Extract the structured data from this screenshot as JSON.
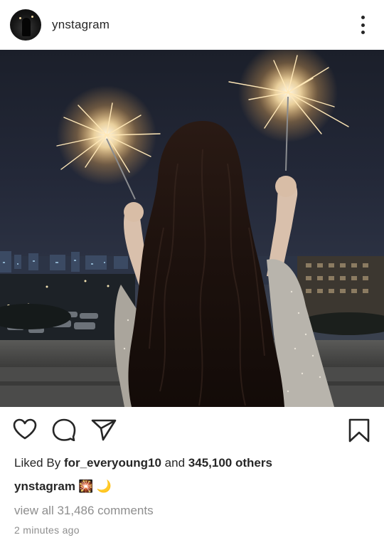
{
  "post": {
    "username": "ynstagram",
    "likes": {
      "prefix": "Liked By",
      "user": "for_everyoung10",
      "joiner": "and",
      "others": "345,100 others"
    },
    "caption": {
      "username": "ynstagram",
      "emoji": "🎇 🌙"
    },
    "comments_link": "view all 31,486 comments",
    "timestamp": "2 minutes ago"
  },
  "icons": {
    "more": "more-vertical-icon",
    "like": "heart-icon",
    "comment": "comment-bubble-icon",
    "share": "paper-plane-icon",
    "save": "bookmark-icon"
  },
  "colors": {
    "text": "#262626",
    "muted": "#8e8e8e"
  }
}
